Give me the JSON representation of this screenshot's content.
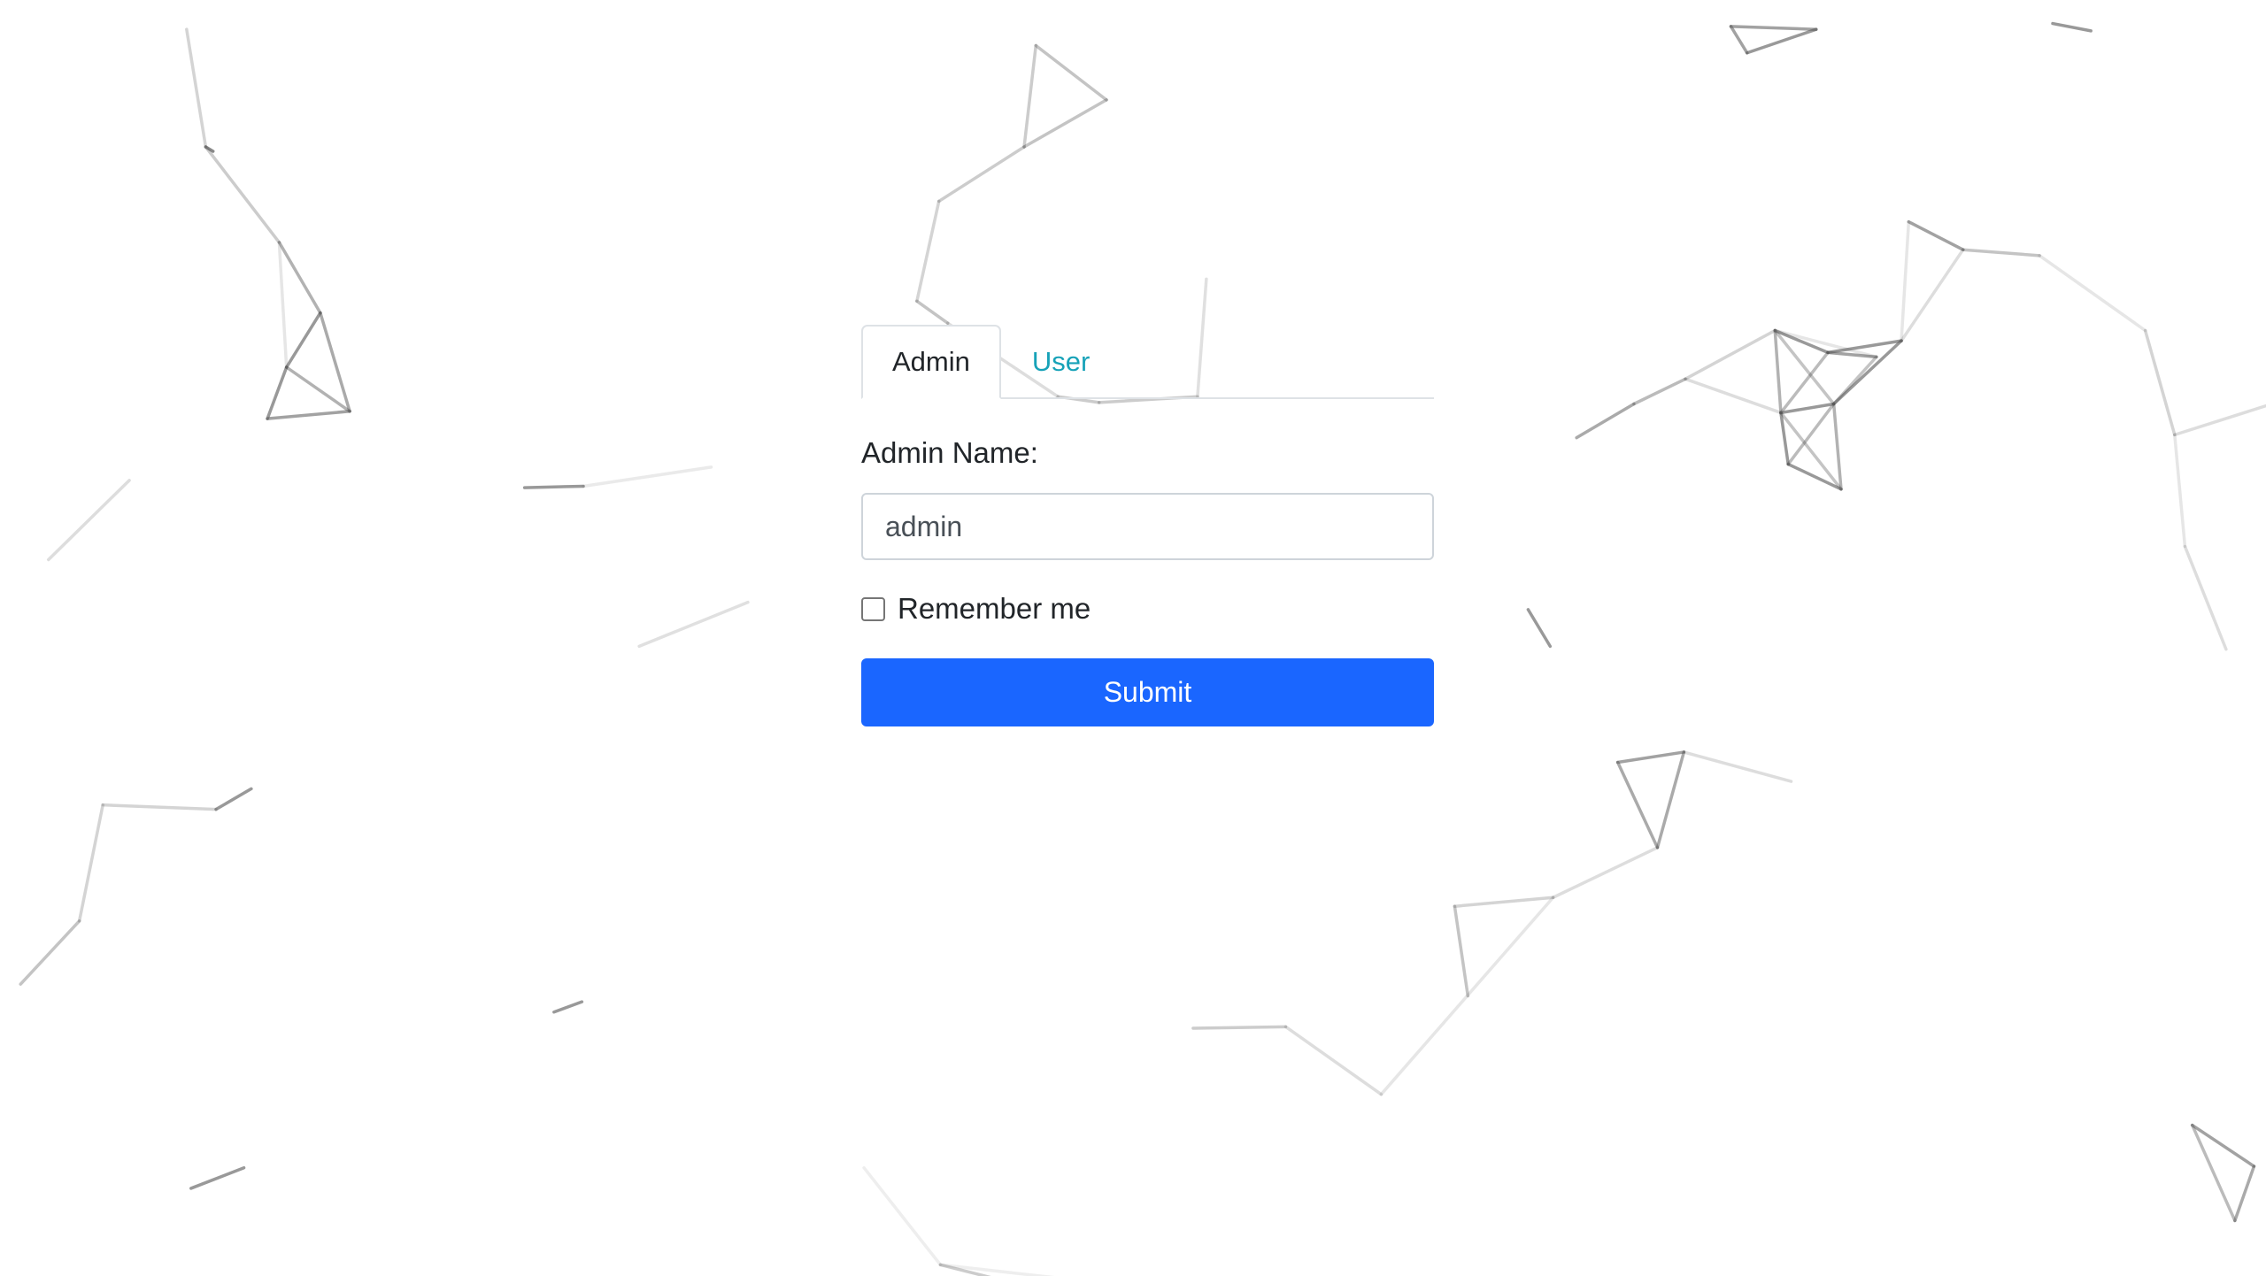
{
  "tabs": {
    "admin_label": "Admin",
    "user_label": "User",
    "active": "Admin"
  },
  "form": {
    "name_label": "Admin Name:",
    "name_value": "admin",
    "remember_label": "Remember me",
    "remember_checked": false,
    "submit_label": "Submit"
  },
  "theme": {
    "accent": "#1a66ff",
    "tab_link": "#17a2b8",
    "background": "#ffffff"
  }
}
